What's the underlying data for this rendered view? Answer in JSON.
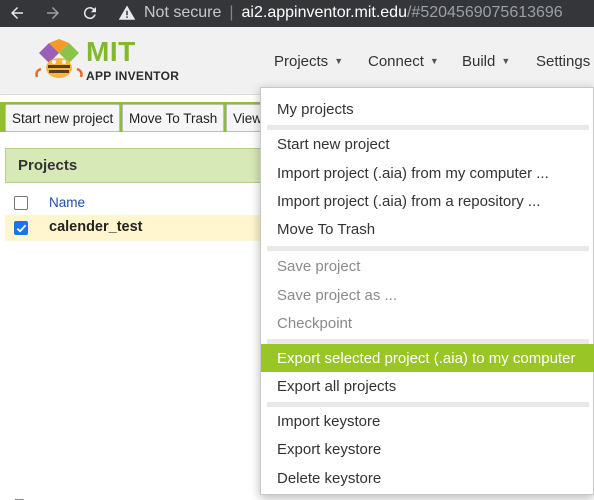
{
  "browser": {
    "security_label": "Not secure",
    "separator": "|",
    "host": "ai2.appinventor.mit.edu",
    "path": "/#5204569075613696"
  },
  "app": {
    "logo_title": "MIT",
    "logo_subtitle": "APP INVENTOR",
    "top_menu": [
      "Projects",
      "Connect",
      "Build",
      "Settings"
    ]
  },
  "toolbar": {
    "start_new": "Start new project",
    "move_to_trash": "Move To Trash",
    "view": "View"
  },
  "projects_panel": {
    "title": "Projects",
    "column_name": "Name",
    "rows": [
      {
        "name": "calender_test",
        "checked": true
      }
    ]
  },
  "dropdown": {
    "groups": [
      [
        {
          "label": "My projects",
          "enabled": true
        }
      ],
      [
        {
          "label": "Start new project",
          "enabled": true
        },
        {
          "label": "Import project (.aia) from my computer ...",
          "enabled": true
        },
        {
          "label": "Import project (.aia) from a repository ...",
          "enabled": true
        },
        {
          "label": "Move To Trash",
          "enabled": true
        }
      ],
      [
        {
          "label": "Save project",
          "enabled": false
        },
        {
          "label": "Save project as ...",
          "enabled": false
        },
        {
          "label": "Checkpoint",
          "enabled": false
        }
      ],
      [
        {
          "label": "Export selected project (.aia) to my computer",
          "enabled": true,
          "highlighted": true
        },
        {
          "label": "Export all projects",
          "enabled": true
        }
      ],
      [
        {
          "label": "Import keystore",
          "enabled": true
        },
        {
          "label": "Export keystore",
          "enabled": true
        },
        {
          "label": "Delete keystore",
          "enabled": true
        }
      ]
    ],
    "highlight_color": "#9ac527"
  },
  "colors": {
    "chrome_bg": "#35363a",
    "brand_green": "#82b92c",
    "panel_header": "#d8e9b8",
    "selected_row": "#fff6cf"
  }
}
